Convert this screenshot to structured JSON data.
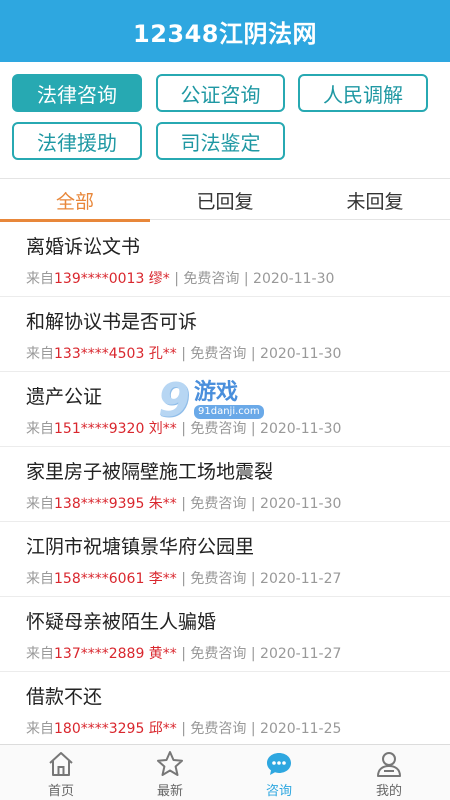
{
  "header": {
    "title": "12348江阴法网"
  },
  "categories": [
    {
      "label": "法律咨询",
      "active": true
    },
    {
      "label": "公证咨询",
      "active": false
    },
    {
      "label": "人民调解",
      "active": false
    },
    {
      "label": "法律援助",
      "active": false
    },
    {
      "label": "司法鉴定",
      "active": false
    }
  ],
  "tabs": [
    {
      "label": "全部",
      "active": true
    },
    {
      "label": "已回复",
      "active": false
    },
    {
      "label": "未回复",
      "active": false
    }
  ],
  "list": [
    {
      "title": "离婚诉讼文书",
      "from": "来自",
      "user": "139****0013 缪*",
      "meta": " | 免费咨询 | 2020-11-30"
    },
    {
      "title": "和解协议书是否可诉",
      "from": "来自",
      "user": "133****4503 孔**",
      "meta": " | 免费咨询 | 2020-11-30"
    },
    {
      "title": "遗产公证",
      "from": "来自",
      "user": "151****9320 刘**",
      "meta": " | 免费咨询 | 2020-11-30"
    },
    {
      "title": "家里房子被隔壁施工场地震裂",
      "from": "来自",
      "user": "138****9395 朱**",
      "meta": " | 免费咨询 | 2020-11-30"
    },
    {
      "title": "江阴市祝塘镇景华府公园里",
      "from": "来自",
      "user": "158****6061 李**",
      "meta": " | 免费咨询 | 2020-11-27"
    },
    {
      "title": "怀疑母亲被陌生人骗婚",
      "from": "来自",
      "user": "137****2889 黄**",
      "meta": " | 免费咨询 | 2020-11-27"
    },
    {
      "title": "借款不还",
      "from": "来自",
      "user": "180****3295 邱**",
      "meta": " | 免费咨询 | 2020-11-25"
    }
  ],
  "watermark": {
    "number": "9",
    "text": "游戏",
    "url": "91danji.com"
  },
  "bottom_nav": [
    {
      "label": "首页",
      "icon": "home-icon",
      "active": false
    },
    {
      "label": "最新",
      "icon": "star-icon",
      "active": false
    },
    {
      "label": "咨询",
      "icon": "chat-icon",
      "active": true
    },
    {
      "label": "我的",
      "icon": "user-icon",
      "active": false
    }
  ],
  "colors": {
    "header": "#2ea7e0",
    "category_border": "#27a9b2",
    "tab_active": "#e8873a",
    "user_highlight": "#d9272e",
    "nav_active": "#2ea7e0"
  }
}
